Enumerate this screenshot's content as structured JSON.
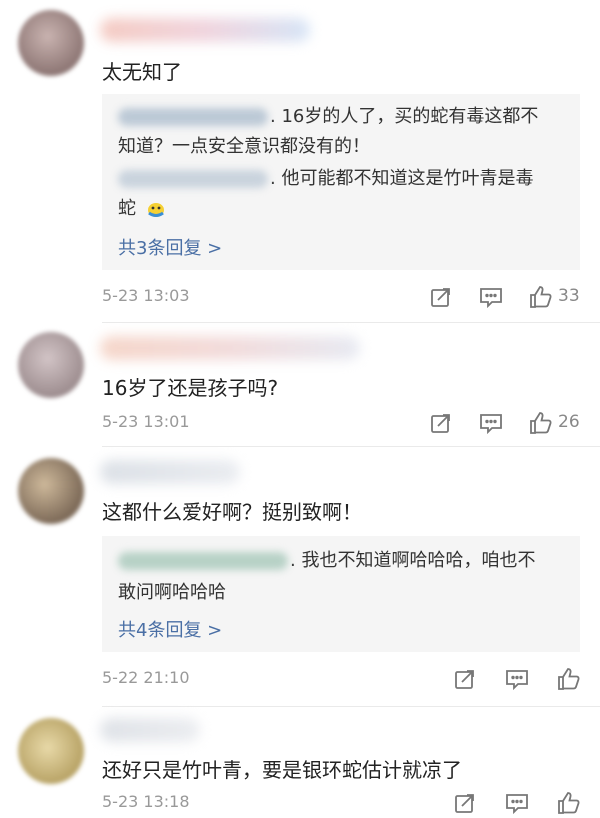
{
  "comments": [
    {
      "text": "太无知了",
      "replies": [
        {
          "line1": ". 16岁的人了，买的蛇有毒这都不",
          "line2": "知道？一点安全意识都没有的！"
        },
        {
          "line1": ". 他可能都不知道这是竹叶青是毒",
          "line2": "蛇"
        }
      ],
      "more_label": "共3条回复 >",
      "time": "5-23 13:03",
      "likes": "33"
    },
    {
      "text": "16岁了还是孩子吗?",
      "time": "5-23 13:01",
      "likes": "26"
    },
    {
      "text": "这都什么爱好啊？挺别致啊！",
      "replies": [
        {
          "line1": ". 我也不知道啊哈哈哈，咱也不",
          "line2": "敢问啊哈哈哈"
        }
      ],
      "more_label": "共4条回复 >",
      "time": "5-22 21:10",
      "likes": ""
    },
    {
      "text": "还好只是竹叶青，要是银环蛇估计就凉了",
      "time": "5-23 13:18",
      "likes": ""
    }
  ],
  "colors": {
    "link": "#4a6fa5",
    "meta": "#999999",
    "reply_bg": "#f5f5f5"
  },
  "icons": [
    "forward-icon",
    "comment-icon",
    "like-icon",
    "emoji-icon"
  ]
}
